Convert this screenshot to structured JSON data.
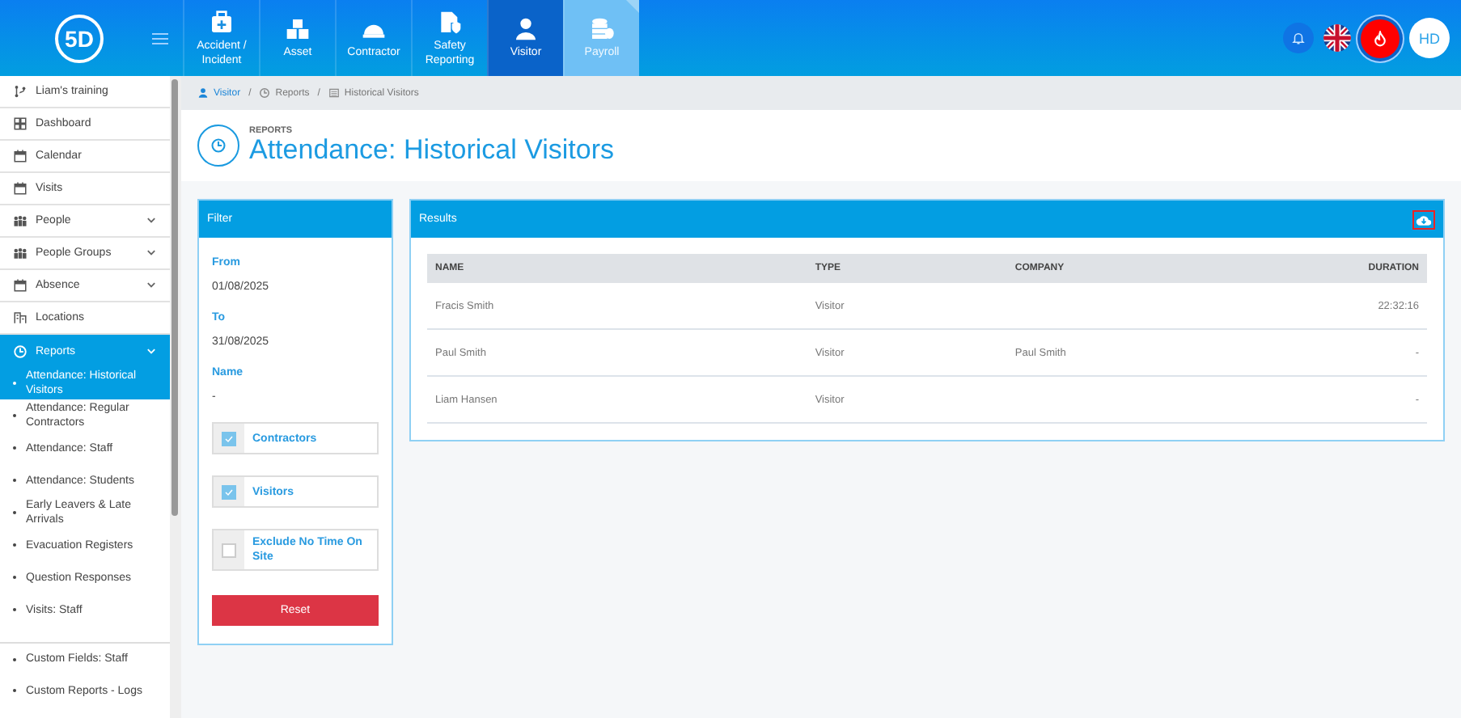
{
  "header": {
    "logo": "5D",
    "nav": [
      {
        "label": "Accident / Incident",
        "selected": false,
        "faded": false
      },
      {
        "label": "Asset",
        "selected": false,
        "faded": false
      },
      {
        "label": "Contractor",
        "selected": false,
        "faded": false
      },
      {
        "label": "Safety Reporting",
        "selected": false,
        "faded": false
      },
      {
        "label": "Visitor",
        "selected": true,
        "faded": false
      },
      {
        "label": "Payroll",
        "selected": false,
        "faded": true
      }
    ],
    "avatar": "HD"
  },
  "sidebar": {
    "items": [
      {
        "label": "Liam's training",
        "expandable": false,
        "selected": false
      },
      {
        "label": "Dashboard",
        "expandable": false,
        "selected": false
      },
      {
        "label": "Calendar",
        "expandable": false,
        "selected": false
      },
      {
        "label": "Visits",
        "expandable": false,
        "selected": false
      },
      {
        "label": "People",
        "expandable": true,
        "selected": false
      },
      {
        "label": "People Groups",
        "expandable": true,
        "selected": false
      },
      {
        "label": "Absence",
        "expandable": true,
        "selected": false
      },
      {
        "label": "Locations",
        "expandable": false,
        "selected": false
      },
      {
        "label": "Reports",
        "expandable": true,
        "selected": true,
        "children": [
          {
            "label": "Attendance: Historical Visitors",
            "selected": true,
            "separated": false
          },
          {
            "label": "Attendance: Regular Contractors",
            "selected": false,
            "separated": false
          },
          {
            "label": "Attendance: Staff",
            "selected": false,
            "separated": false
          },
          {
            "label": "Attendance: Students",
            "selected": false,
            "separated": false
          },
          {
            "label": "Early Leavers & Late Arrivals",
            "selected": false,
            "separated": false
          },
          {
            "label": "Evacuation Registers",
            "selected": false,
            "separated": false
          },
          {
            "label": "Question Responses",
            "selected": false,
            "separated": false
          },
          {
            "label": "Visits: Staff",
            "selected": false,
            "separated": false
          },
          {
            "label": "Custom Fields: Staff",
            "selected": false,
            "separated": true
          },
          {
            "label": "Custom Reports - Logs",
            "selected": false,
            "separated": false
          }
        ]
      }
    ]
  },
  "breadcrumb": [
    {
      "label": "Visitor"
    },
    {
      "separator": "/",
      "label": "Reports"
    },
    {
      "separator": "/",
      "label": "Historical Visitors"
    }
  ],
  "page": {
    "kicker": "REPORTS",
    "title": "Attendance: Historical Visitors"
  },
  "filter": {
    "title": "Filter",
    "fields": [
      {
        "label": "From",
        "value": "01/08/2025"
      },
      {
        "label": "To",
        "value": "31/08/2025"
      },
      {
        "label": "Name",
        "value": "-"
      }
    ],
    "checkboxes": [
      {
        "label": "Contractors",
        "checked": true
      },
      {
        "label": "Visitors",
        "checked": true
      },
      {
        "label": "Exclude No Time On Site",
        "checked": false
      }
    ],
    "reset": "Reset"
  },
  "results": {
    "title": "Results",
    "table": {
      "columns": [
        "NAME",
        "TYPE",
        "COMPANY",
        "DURATION"
      ],
      "rows": [
        [
          "Fracis Smith",
          "Visitor",
          "",
          "22:32:16"
        ],
        [
          "Paul Smith",
          "Visitor",
          "Paul Smith",
          "-"
        ],
        [
          "Liam Hansen",
          "Visitor",
          "",
          "-"
        ]
      ]
    }
  }
}
